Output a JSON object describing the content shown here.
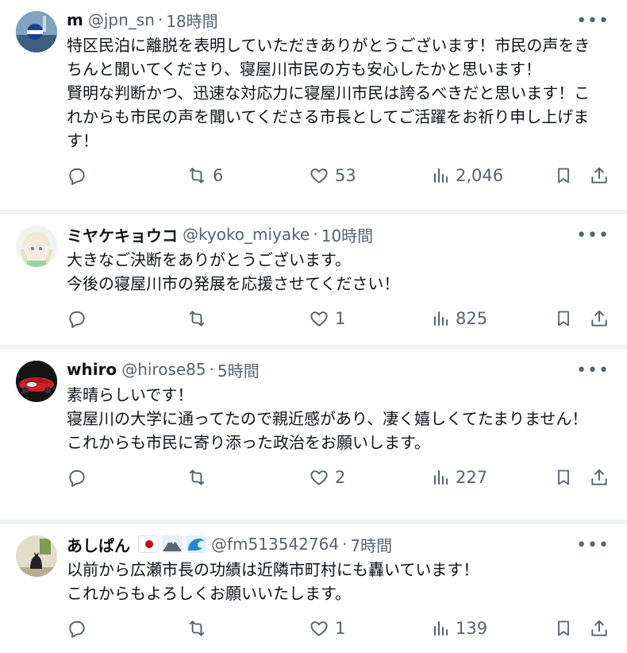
{
  "tweets": [
    {
      "name": "m",
      "handle": "@jpn_sn",
      "time": "18時間",
      "text": "特区民泊に離脱を表明していただきありがとうございます！市民の声をきちんと聞いてくださり、寝屋川市民の方も安心したかと思います！\n賢明な判断かつ、迅速な対応力に寝屋川市民は誇るべきだと思います！これからも市民の声を聞いてくださる市長としてご活躍をお祈り申し上げます！",
      "replies": "",
      "retweets": "6",
      "likes": "53",
      "views": "2,046"
    },
    {
      "name": "ミヤケキョウコ",
      "handle": "@kyoko_miyake",
      "time": "10時間",
      "text": "大きなご決断をありがとうございます。\n今後の寝屋川市の発展を応援させてください！",
      "replies": "",
      "retweets": "",
      "likes": "1",
      "views": "825"
    },
    {
      "name": "whiro",
      "handle": "@hirose85",
      "time": "5時間",
      "text": "素晴らしいです！\n寝屋川の大学に通ってたので親近感があり、凄く嬉しくてたまりません！\nこれからも市民に寄り添った政治をお願いします。",
      "replies": "",
      "retweets": "",
      "likes": "2",
      "views": "227"
    },
    {
      "name": "あしぱん",
      "handle": "@fm513542764",
      "time": "7時間",
      "text": "以前から広瀬市長の功績は近隣市町村にも轟いています！\nこれからもよろしくお願いいたします。",
      "replies": "",
      "retweets": "",
      "likes": "1",
      "views": "139"
    }
  ],
  "icons": {
    "reply": "reply-icon",
    "retweet": "retweet-icon",
    "like": "heart-icon",
    "views": "views-icon",
    "bookmark": "bookmark-icon",
    "share": "share-icon",
    "more": "more-icon"
  },
  "colors": {
    "text": "#0f1419",
    "muted": "#536471",
    "divider": "#eff3f4"
  }
}
